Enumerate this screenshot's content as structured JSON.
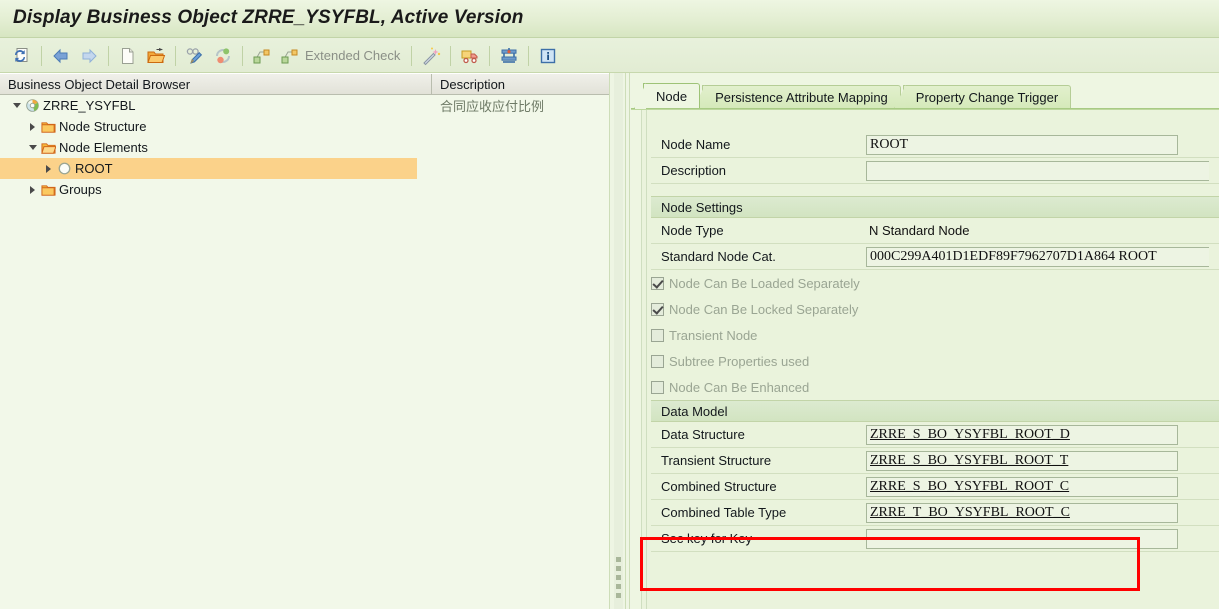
{
  "window": {
    "title": "Display Business Object ZRRE_YSYFBL, Active Version"
  },
  "toolbar": {
    "items": [
      {
        "name": "refresh-icon",
        "label": ""
      },
      {
        "name": "back-icon",
        "label": ""
      },
      {
        "name": "forward-icon",
        "label": ""
      },
      {
        "name": "new-document-icon",
        "label": ""
      },
      {
        "name": "open-folder-icon",
        "label": ""
      },
      {
        "name": "display-check-icon",
        "label": ""
      },
      {
        "name": "activate-icon",
        "label": ""
      },
      {
        "name": "check-hierarchy-icon",
        "label": ""
      },
      {
        "name": "extended-check-icon",
        "label": "Extended Check"
      },
      {
        "name": "magic-wand-icon",
        "label": ""
      },
      {
        "name": "transport-truck-icon",
        "label": ""
      },
      {
        "name": "press-clamp-icon",
        "label": ""
      },
      {
        "name": "info-icon",
        "label": ""
      }
    ],
    "extended_check_label": "Extended Check"
  },
  "tree": {
    "columns": [
      "Business Object Detail Browser",
      "Description"
    ],
    "rows": [
      {
        "label": "ZRRE_YSYFBL",
        "description": "合同应收应付比例",
        "indent": 0,
        "twisty": "open",
        "icon": "business-object-icon",
        "selected": false
      },
      {
        "label": "Node Structure",
        "description": "",
        "indent": 1,
        "twisty": "closed",
        "icon": "folder-icon",
        "selected": false
      },
      {
        "label": "Node Elements",
        "description": "",
        "indent": 1,
        "twisty": "open",
        "icon": "folder-open-icon",
        "selected": false
      },
      {
        "label": "ROOT",
        "description": "",
        "indent": 2,
        "twisty": "closed",
        "icon": "node-icon",
        "selected": true
      },
      {
        "label": "Groups",
        "description": "",
        "indent": 1,
        "twisty": "closed",
        "icon": "folder-icon",
        "selected": false
      }
    ]
  },
  "detail": {
    "tabs": [
      {
        "label": "Node",
        "active": true
      },
      {
        "label": "Persistence Attribute Mapping",
        "active": false
      },
      {
        "label": "Property Change Trigger",
        "active": false
      }
    ],
    "header_fields": [
      {
        "label": "Node Name",
        "value": "ROOT"
      },
      {
        "label": "Description",
        "value": ""
      }
    ],
    "node_settings": {
      "title": "Node Settings",
      "fields": [
        {
          "label": "Node Type",
          "value": "N Standard Node"
        },
        {
          "label": "Standard Node Cat.",
          "value": "000C299A401D1EDF89F7962707D1A864 ROOT"
        }
      ],
      "checkboxes": [
        {
          "label": "Node Can Be Loaded Separately",
          "checked": true
        },
        {
          "label": "Node Can Be Locked Separately",
          "checked": true
        },
        {
          "label": "Transient Node",
          "checked": false
        },
        {
          "label": "Subtree Properties used",
          "checked": false
        },
        {
          "label": "Node Can Be Enhanced",
          "checked": false
        }
      ]
    },
    "data_model": {
      "title": "Data Model",
      "fields": [
        {
          "label": "Data Structure",
          "value": "ZRRE_S_BO_YSYFBL_ROOT_D",
          "highlight": false
        },
        {
          "label": "Transient Structure",
          "value": "ZRRE_S_BO_YSYFBL_ROOT_T",
          "highlight": false
        },
        {
          "label": "Combined Structure",
          "value": "ZRRE_S_BO_YSYFBL_ROOT_C",
          "highlight": true
        },
        {
          "label": "Combined Table Type",
          "value": "ZRRE_T_BO_YSYFBL_ROOT_C",
          "highlight": true
        },
        {
          "label": "Sec key for Key",
          "value": "",
          "highlight": false
        }
      ]
    }
  },
  "colors": {
    "accent_green": "#9ec377",
    "panel_bg": "#eef6e2",
    "selection": "#fbd28a",
    "highlight_border": "#ff0000"
  }
}
